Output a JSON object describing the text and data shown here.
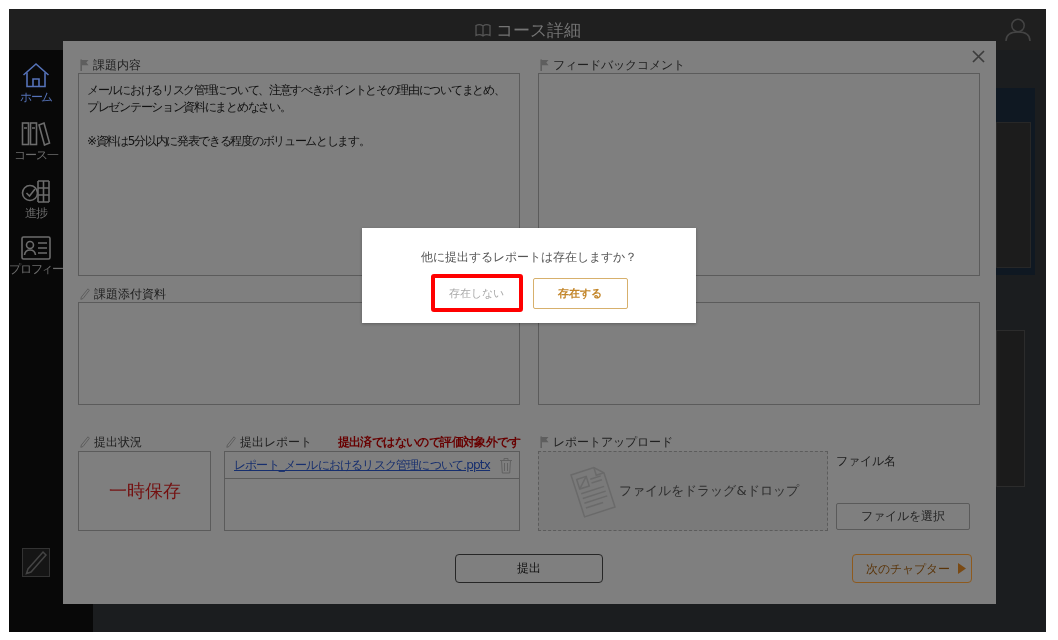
{
  "header": {
    "title": "コース詳細"
  },
  "sidebar": {
    "items": [
      {
        "label": "ホーム",
        "selected": true
      },
      {
        "label": "コース一",
        "selected": false
      },
      {
        "label": "進捗",
        "selected": false
      },
      {
        "label": "プロフィー",
        "selected": false
      }
    ]
  },
  "modal": {
    "assignment": {
      "label": "課題内容",
      "paragraphs": [
        "メールにおけるリスク管理について、注意すべきポイントとその理由についてまとめ、プレゼンテーション資料にまとめなさい。",
        "※資料は5分以内に発表できる程度のボリュームとします。"
      ]
    },
    "feedback": {
      "label": "フィードバックコメント"
    },
    "attachments": {
      "label": "課題添付資料"
    },
    "submission_status": {
      "label": "提出状況",
      "value": "一時保存"
    },
    "submitted_reports": {
      "label": "提出レポート",
      "notice": "提出済ではないので評価対象外です",
      "files": [
        {
          "name": "レポート_メールにおけるリスク管理について.pptx"
        }
      ]
    },
    "upload": {
      "label": "レポートアップロード",
      "placeholder": "ファイルをドラッグ&ドロップ",
      "file_name_label": "ファイル名",
      "choose_button": "ファイルを選択"
    },
    "buttons": [
      {
        "label": "提出",
        "kind": "submit"
      },
      {
        "label": "次のチャプター",
        "kind": "next"
      }
    ]
  },
  "dialog": {
    "message": "他に提出するレポートは存在しますか？",
    "buttons": [
      {
        "label": "存在しない",
        "kind": "secondary",
        "highlighted": true
      },
      {
        "label": "存在する",
        "kind": "primary",
        "highlighted": false
      }
    ]
  }
}
